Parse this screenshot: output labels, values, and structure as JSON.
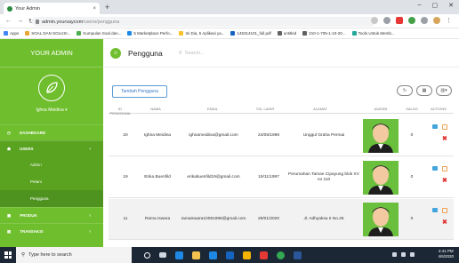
{
  "browser": {
    "tab_title": "Your Admin",
    "tab_close": "×",
    "new_tab": "+",
    "win_min": "–",
    "win_max": "▢",
    "win_close": "✕",
    "url_host": "admin.yoursaycom",
    "url_path": "/users/pengguna",
    "bookmarks": [
      "Apps",
      "SOAL DAN SOLUSI...",
      "Kumpulan Soal dan...",
      "5 Marketplace Perfo...",
      "Ini Dia, 5 Aplikasi ya...",
      "145314101_full.pdf",
      "untitled",
      "210-1-705-1-10-20...",
      "Tools Untuk Memb..."
    ]
  },
  "sidebar": {
    "brand": "YOUR ADMIN",
    "user_name": "Ighna Meidina",
    "menu": [
      {
        "label": "DASHBOARD"
      },
      {
        "label": "USERS",
        "chevron": "‹"
      },
      {
        "label": "PRODUK",
        "chevron": "‹"
      },
      {
        "label": "TRANSAKSI",
        "chevron": "‹"
      }
    ],
    "submenu": [
      "Admin",
      "Petani",
      "Pengguna"
    ]
  },
  "header": {
    "page_title": "Pengguna",
    "search_placeholder": "Search..."
  },
  "toolbar": {
    "add_label": "Tambah Pengguna"
  },
  "table": {
    "columns": [
      "ID PENGGUNA",
      "NAMA",
      "EMAIL",
      "TGL LAHIR",
      "ALAMAT",
      "AVATAR",
      "SALDO",
      "ACTIONS"
    ],
    "rows": [
      {
        "id": "20",
        "nama": "Ighna Meidina",
        "email": "ighnameidina@gmail.com",
        "tgl": "24/05/1998",
        "alamat": "Unggul Graha Permai",
        "saldo": "0"
      },
      {
        "id": "19",
        "nama": "Erika Buenfild",
        "email": "erikabuenfild19@gmail.com",
        "tgl": "19/11/1997",
        "alamat": "Perumahan Taman Cipayung blok XV no 110",
        "saldo": "0"
      },
      {
        "id": "11",
        "nama": "Rama Iswara",
        "email": "ramaiswara10081998@gmail.com",
        "tgl": "29/01/2020",
        "alamat": "Jl. Adhyaksa II No.25",
        "saldo": "0"
      }
    ]
  },
  "taskbar": {
    "search_placeholder": "Type here to search",
    "time": "4:41 PM",
    "date": "4/6/2020"
  }
}
